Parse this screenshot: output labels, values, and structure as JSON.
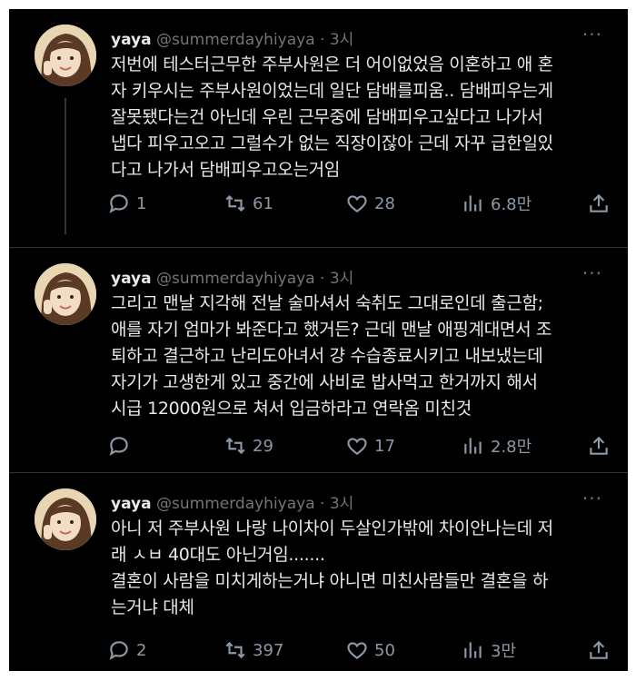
{
  "tweets": [
    {
      "name": "yaya",
      "handle": "@summerdayhiyaya",
      "time": "· 3시",
      "more": "···",
      "text": "저번에 테스터근무한 주부사원은 더 어이없었음 이혼하고 애 혼\n자 키우시는 주부사원이었는데 일단 담배를피움.. 담배피우는게\n잘못됐다는건 아닌데 우린 근무중에 담배피우고싶다고 나가서\n냅다 피우고오고 그럴수가 없는 직장이잖아 근데 자꾸 급한일있\n다고 나가서 담배피우고오는거임",
      "replies": "1",
      "retweets": "61",
      "likes": "28",
      "views": "6.8만"
    },
    {
      "name": "yaya",
      "handle": "@summerdayhiyaya",
      "time": "· 3시",
      "more": "···",
      "text": "그리고 맨날 지각해 전날 술마셔서 숙취도 그대로인데 출근함;\n애를 자기 엄마가 봐준다고 했거든? 근데 맨날 애핑계대면서 조\n퇴하고 결근하고 난리도아녀서 걍 수습종료시키고 내보냈는데\n자기가 고생한게 있고 중간에 사비로 밥사먹고 한거까지 해서\n시급 12000원으로 쳐서 입금하라고 연락옴 미친것",
      "replies": "",
      "retweets": "29",
      "likes": "17",
      "views": "2.8만"
    },
    {
      "name": "yaya",
      "handle": "@summerdayhiyaya",
      "time": "· 3시",
      "more": "···",
      "text": "아니 저 주부사원 나랑 나이차이 두살인가밖에 차이안나는데 저\n래 ㅅㅂ 40대도 아닌거임.......\n결혼이 사람을 미치게하는거냐 아니면 미친사람들만 결혼을 하\n는거냐 대체",
      "replies": "2",
      "retweets": "397",
      "likes": "50",
      "views": "3만"
    }
  ],
  "icons": [
    "reply-icon",
    "retweet-icon",
    "like-icon",
    "views-icon",
    "share-icon"
  ],
  "colors": {
    "background": "#000000",
    "text": "#e7e9ea",
    "secondary": "#71767b",
    "divider": "#2f3336"
  }
}
